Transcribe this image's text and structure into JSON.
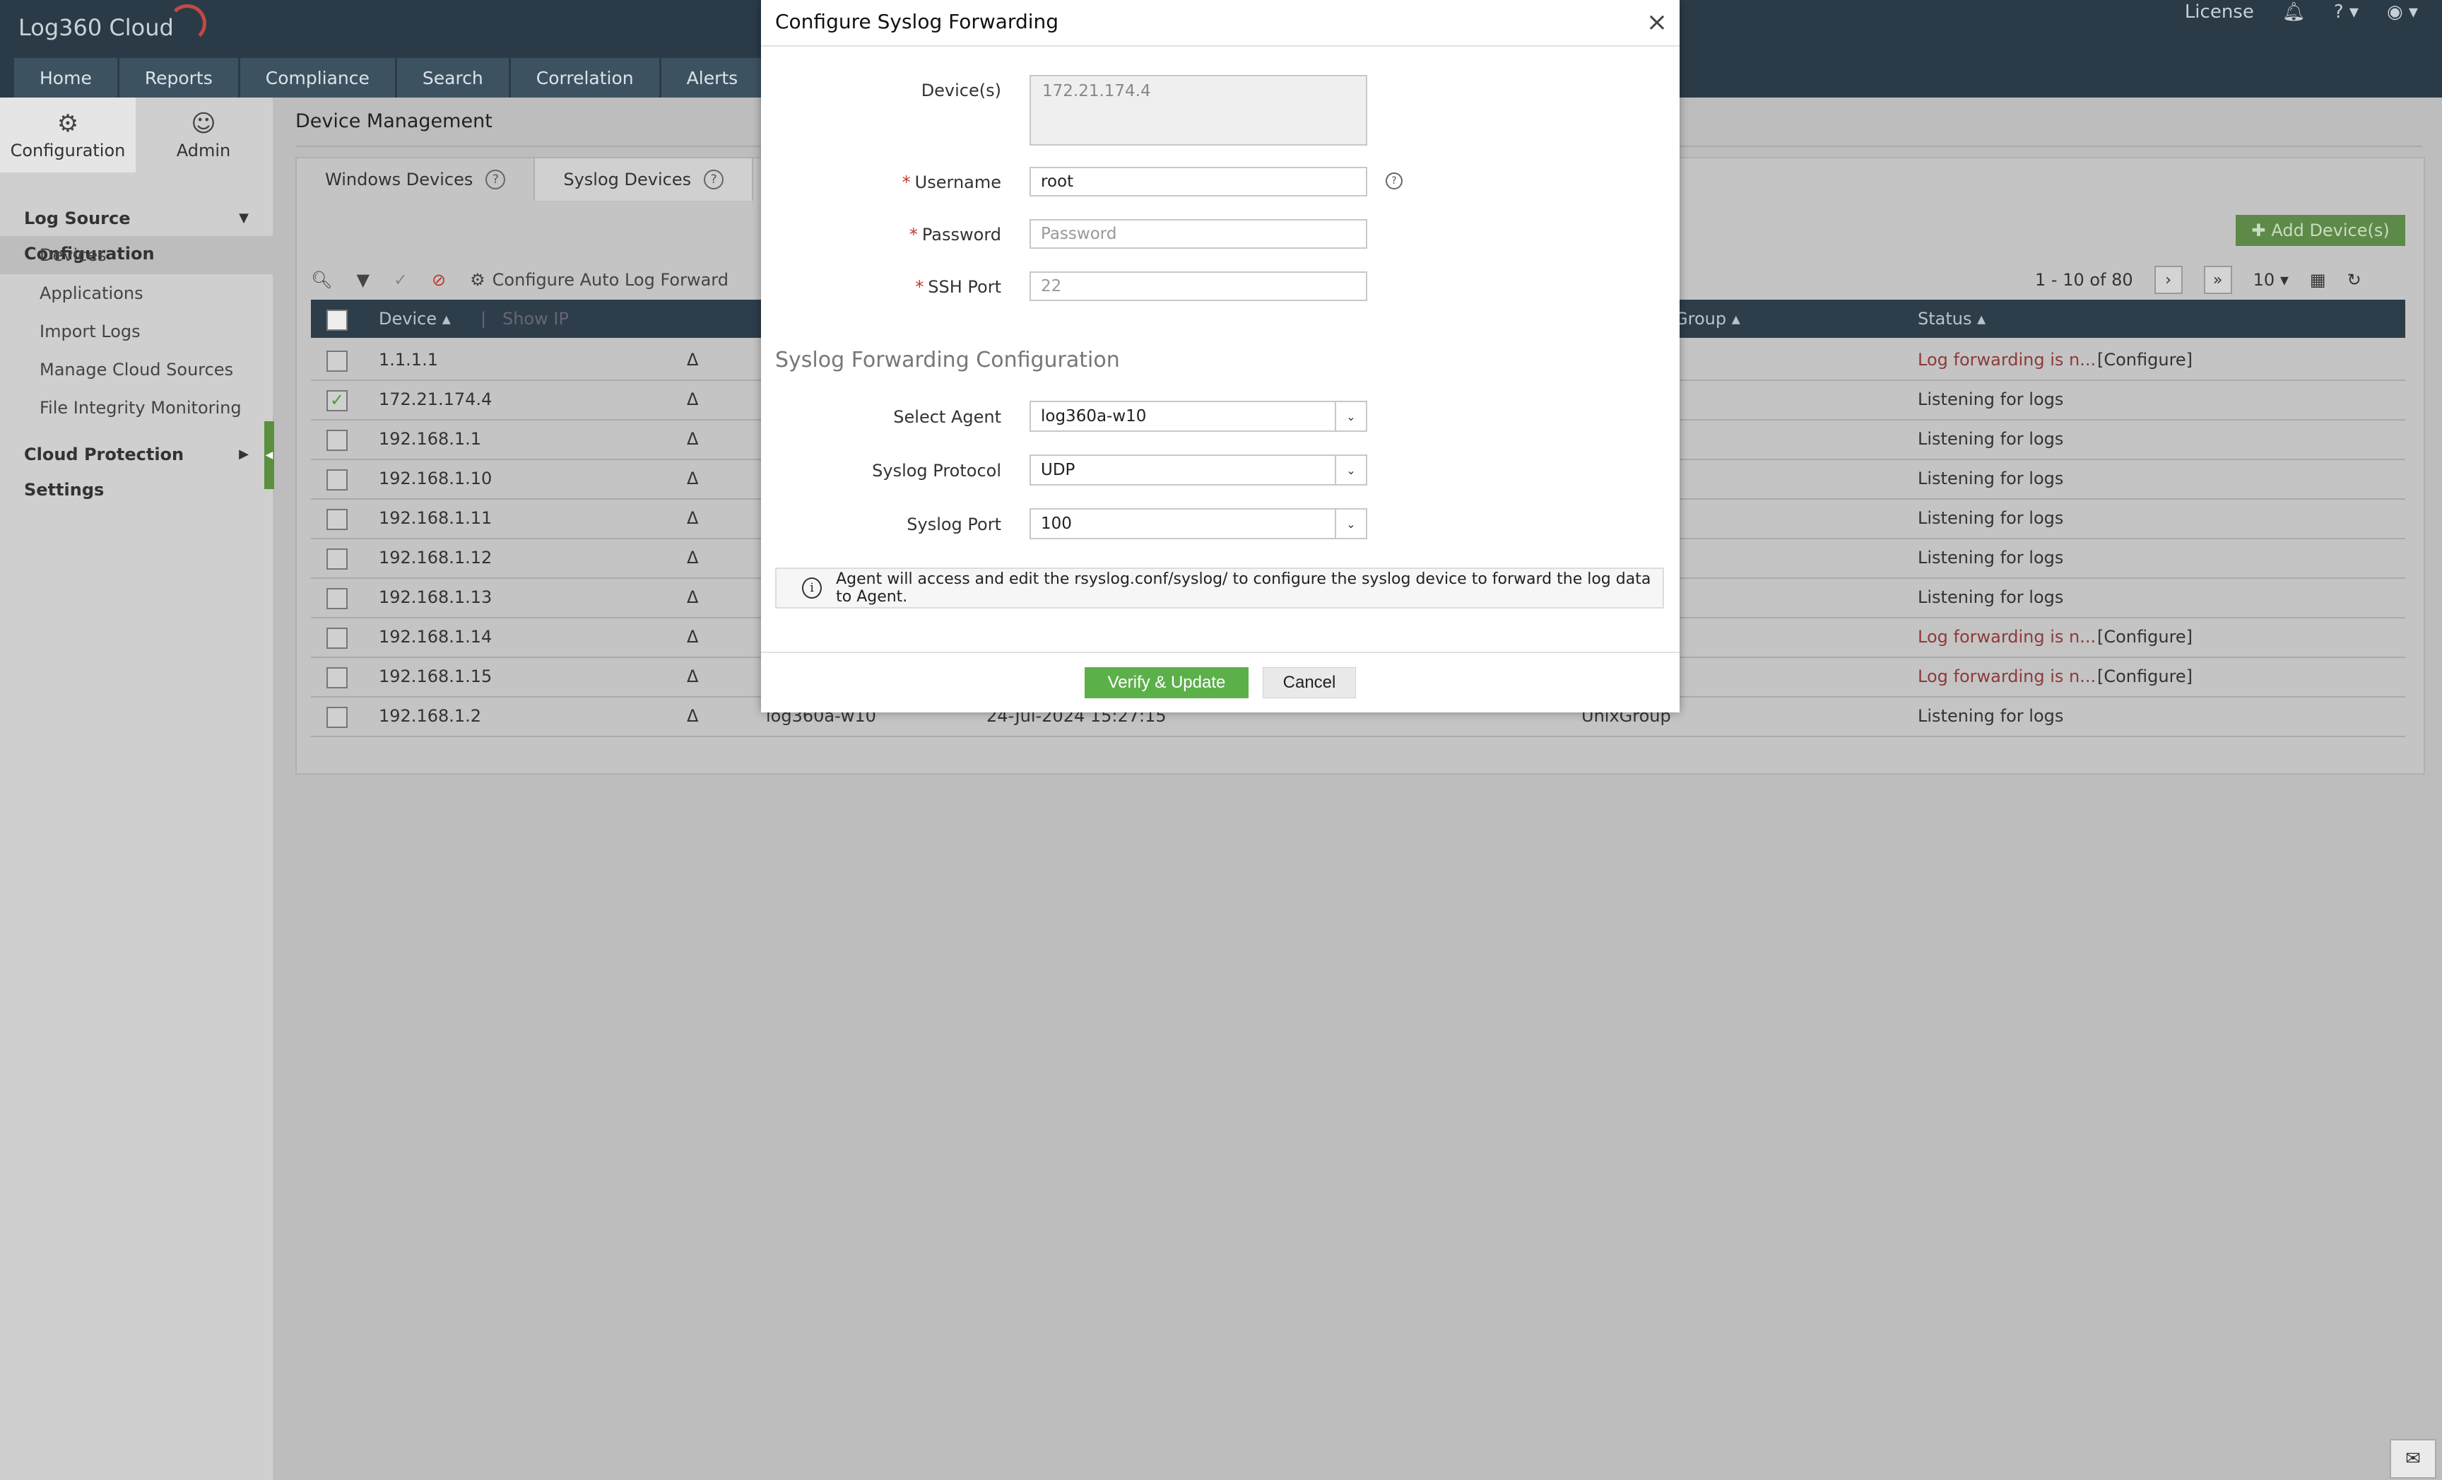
{
  "app": {
    "logo_text": "Log360 Cloud",
    "license_label": "License"
  },
  "nav": [
    "Home",
    "Reports",
    "Compliance",
    "Search",
    "Correlation",
    "Alerts"
  ],
  "sidebar": {
    "tabs": [
      {
        "label": "Configuration",
        "icon": "gear-icon"
      },
      {
        "label": "Admin",
        "icon": "user-icon"
      }
    ],
    "section1": "Log Source Configuration",
    "items": [
      "Devices",
      "Applications",
      "Import Logs",
      "Manage Cloud Sources",
      "File Integrity Monitoring"
    ],
    "section2": "Cloud Protection Settings"
  },
  "page": {
    "title": "Device Management",
    "tabs": [
      "Windows Devices",
      "Syslog Devices"
    ],
    "add_button": "Add Device(s)",
    "toolbar_configure": "Configure Auto Log Forward",
    "pager_text": "1 - 10 of 80",
    "page_size": "10",
    "columns": {
      "device": "Device",
      "show_ip": "Show IP",
      "group": "Group",
      "status": "Status"
    },
    "rows": [
      {
        "device": "1.1.1.1",
        "agent": "",
        "time": "",
        "group": "",
        "status": "Log forwarding is n...",
        "configure": "[Configure]",
        "error": true,
        "checked": false
      },
      {
        "device": "172.21.174.4",
        "agent": "",
        "time": "",
        "group": "",
        "status": "Listening for logs",
        "configure": "",
        "error": false,
        "checked": true
      },
      {
        "device": "192.168.1.1",
        "agent": "",
        "time": "",
        "group": "",
        "status": "Listening for logs",
        "configure": "",
        "error": false,
        "checked": false
      },
      {
        "device": "192.168.1.10",
        "agent": "",
        "time": "",
        "group": "",
        "status": "Listening for logs",
        "configure": "",
        "error": false,
        "checked": false
      },
      {
        "device": "192.168.1.11",
        "agent": "",
        "time": "",
        "group": "",
        "status": "Listening for logs",
        "configure": "",
        "error": false,
        "checked": false
      },
      {
        "device": "192.168.1.12",
        "agent": "",
        "time": "",
        "group": "",
        "status": "Listening for logs",
        "configure": "",
        "error": false,
        "checked": false
      },
      {
        "device": "192.168.1.13",
        "agent": "",
        "time": "",
        "group": "",
        "status": "Listening for logs",
        "configure": "",
        "error": false,
        "checked": false
      },
      {
        "device": "192.168.1.14",
        "agent": "",
        "time": "",
        "group": "",
        "status": "Log forwarding is n...",
        "configure": "[Configure]",
        "error": true,
        "checked": false
      },
      {
        "device": "192.168.1.15",
        "agent": "",
        "time": "",
        "group": "",
        "status": "Log forwarding is n...",
        "configure": "[Configure]",
        "error": true,
        "checked": false
      },
      {
        "device": "192.168.1.2",
        "agent": "log360a-w10",
        "time": "24-Jul-2024 15:27:15",
        "group": "UnixGroup",
        "status": "Listening for logs",
        "configure": "",
        "error": false,
        "checked": false
      }
    ]
  },
  "modal": {
    "title": "Configure Syslog Forwarding",
    "devices_label": "Device(s)",
    "devices_value": "172.21.174.4",
    "username_label": "Username",
    "username_value": "root",
    "password_label": "Password",
    "password_placeholder": "Password",
    "ssh_label": "SSH Port",
    "ssh_placeholder": "22",
    "section_heading": "Syslog Forwarding Configuration",
    "agent_label": "Select Agent",
    "agent_value": "log360a-w10",
    "protocol_label": "Syslog Protocol",
    "protocol_value": "UDP",
    "port_label": "Syslog Port",
    "port_value": "100",
    "info_text": "Agent will access and edit the rsyslog.conf/syslog/ to configure the syslog device to forward the log data to Agent.",
    "verify_label": "Verify & Update",
    "cancel_label": "Cancel"
  },
  "colors": {
    "accent_green": "#5cb04a",
    "header_dark": "#2a3b47",
    "error_red": "#8e3a3a"
  }
}
